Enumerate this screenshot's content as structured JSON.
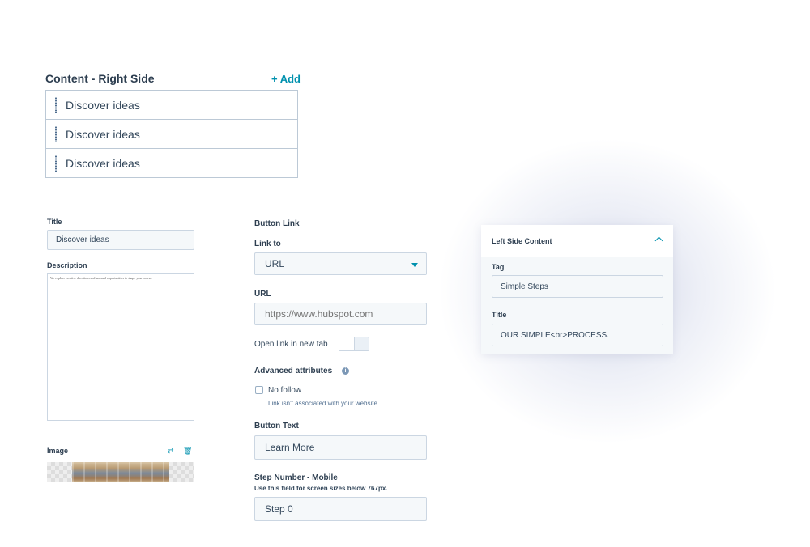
{
  "content_right": {
    "title": "Content - Right Side",
    "add_label": "+ Add",
    "items": [
      "Discover ideas",
      "Discover ideas",
      "Discover ideas"
    ]
  },
  "item_editor": {
    "title_label": "Title",
    "title_value": "Discover ideas",
    "description_label": "Description",
    "description_value": "We explore creative directions and unusual opportunities to shape your course.",
    "image_label": "Image"
  },
  "button_link": {
    "section_label": "Button Link",
    "link_to_label": "Link to",
    "link_to_value": "URL",
    "url_label": "URL",
    "url_placeholder": "https://www.hubspot.com",
    "new_tab_label": "Open link in new tab",
    "advanced_label": "Advanced attributes",
    "no_follow_label": "No follow",
    "no_follow_help": "Link isn't associated with your website",
    "button_text_label": "Button Text",
    "button_text_value": "Learn More",
    "step_number_label": "Step Number - Mobile",
    "step_number_help": "Use this field for screen sizes below 767px.",
    "step_number_value": "Step 0"
  },
  "left_panel": {
    "title": "Left Side Content",
    "tag_label": "Tag",
    "tag_value": "Simple Steps",
    "title_label": "Title",
    "title_value": "OUR SIMPLE<br>PROCESS."
  },
  "colors": {
    "accent": "#0091ae",
    "text": "#33475b",
    "border": "#cbd6e2",
    "input_bg": "#f5f8fa"
  }
}
